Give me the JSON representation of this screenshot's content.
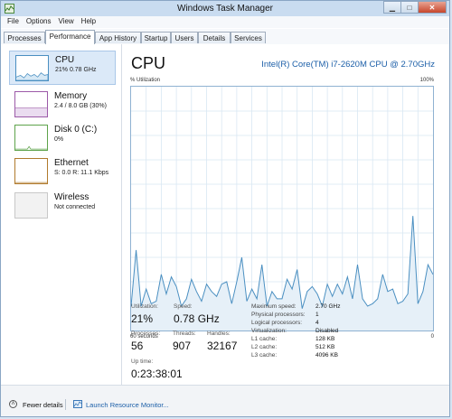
{
  "window": {
    "title": "Windows Task Manager"
  },
  "menu": [
    "File",
    "Options",
    "View",
    "Help"
  ],
  "tabs": [
    "Processes",
    "Performance",
    "App History",
    "Startup",
    "Users",
    "Details",
    "Services"
  ],
  "sidebar": {
    "items": [
      {
        "name": "CPU",
        "sub": "21% 0.78 GHz",
        "color": "#4a8fc1"
      },
      {
        "name": "Memory",
        "sub": "2.4 / 8.0 GB (30%)",
        "color": "#9c5aa8"
      },
      {
        "name": "Disk 0 (C:)",
        "sub": "0%",
        "color": "#5ea34b"
      },
      {
        "name": "Ethernet",
        "sub": "S: 0.0 R: 11.1 Kbps",
        "color": "#b07a2c"
      },
      {
        "name": "Wireless",
        "sub": "Not connected",
        "color": "#bdbdbd"
      }
    ]
  },
  "main": {
    "title": "CPU",
    "cpu_name": "Intel(R) Core(TM) i7-2620M CPU @ 2.70GHz",
    "util_label": "% Utilization",
    "max_label": "100%",
    "time_label": "60 seconds",
    "min_label": "0",
    "stats": {
      "utilization_label": "Utilization:",
      "utilization": "21%",
      "speed_label": "Speed:",
      "speed": "0.78 GHz",
      "processes_label": "Processes:",
      "processes": "56",
      "threads_label": "Threads:",
      "threads": "907",
      "handles_label": "Handles:",
      "handles": "32167",
      "uptime_label": "Up time:",
      "uptime": "0:23:38:01"
    },
    "details": [
      {
        "label": "Maximum speed:",
        "value": "2.70 GHz"
      },
      {
        "label": "Physical processors:",
        "value": "1"
      },
      {
        "label": "Logical processors:",
        "value": "4"
      },
      {
        "label": "Virtualization:",
        "value": "Disabled"
      },
      {
        "label": "L1 cache:",
        "value": "128 KB"
      },
      {
        "label": "L2 cache:",
        "value": "512 KB"
      },
      {
        "label": "L3 cache:",
        "value": "4096 KB"
      }
    ]
  },
  "footer": {
    "fewer_details": "Fewer details",
    "launch": "Launch Resource Monitor..."
  },
  "chart_data": {
    "type": "area",
    "ylim": [
      0,
      100
    ],
    "grid": true,
    "series": [
      {
        "values": [
          10,
          33,
          10,
          17,
          11,
          12,
          23,
          15,
          22,
          18,
          10,
          13,
          21,
          16,
          12,
          19,
          16,
          14,
          19,
          20,
          11,
          20,
          30,
          12,
          17,
          13,
          27,
          10,
          16,
          13,
          13,
          21,
          17,
          25,
          9,
          16,
          18,
          15,
          10,
          19,
          14,
          19,
          15,
          22,
          13,
          27,
          13,
          10,
          11,
          13,
          23,
          16,
          17,
          11,
          12,
          15,
          47,
          11,
          16,
          27,
          23
        ]
      }
    ]
  }
}
